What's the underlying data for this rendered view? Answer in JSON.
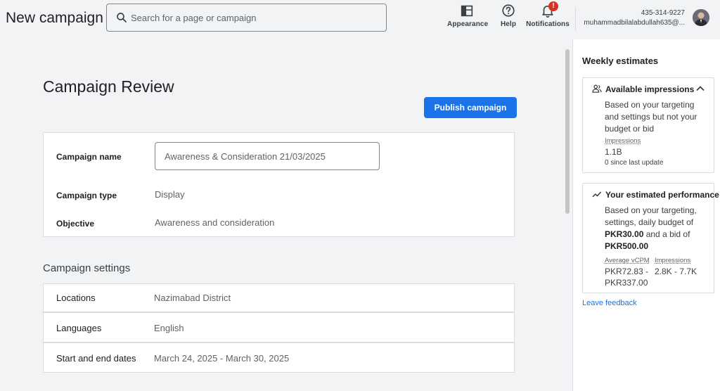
{
  "header": {
    "title": "New campaign",
    "search": {
      "placeholder": "Search for a page or campaign",
      "icon": "search-icon"
    },
    "actions": [
      {
        "label": "Appearance",
        "icon": "appearance-icon"
      },
      {
        "label": "Help",
        "icon": "help-icon"
      },
      {
        "label": "Notifications",
        "icon": "bell-icon",
        "badge": "!"
      }
    ],
    "account": {
      "phone": "435-314-9227",
      "email": "muhammadbilalabdullah635@..."
    }
  },
  "main": {
    "title": "Campaign Review",
    "publish_label": "Publish campaign",
    "details": {
      "name_label": "Campaign name",
      "name_value": "Awareness & Consideration 21/03/2025",
      "type_label": "Campaign type",
      "type_value": "Display",
      "objective_label": "Objective",
      "objective_value": "Awareness and consideration"
    },
    "settings_title": "Campaign settings",
    "settings": [
      {
        "label": "Locations",
        "value": "Nazimabad District"
      },
      {
        "label": "Languages",
        "value": "English"
      },
      {
        "label": "Start and end dates",
        "value": "March 24, 2025 - March 30, 2025"
      }
    ]
  },
  "panel": {
    "title": "Weekly estimates",
    "impressions": {
      "title": "Available impressions",
      "desc": "Based on your targeting and settings but not your budget or bid",
      "stat_label": "Impressions",
      "stat_value": "1.1B",
      "note": "0 since last update"
    },
    "performance": {
      "title": "Your estimated performance",
      "desc_pre": "Based on your targeting, settings, daily budget of ",
      "budget": "PKR30.00",
      "desc_mid": " and a bid of ",
      "bid": "PKR500.00",
      "cpm_label": "Average vCPM",
      "cpm_value_1": "PKR72.83 -",
      "cpm_value_2": "PKR337.00",
      "imp_label": "Impressions",
      "imp_value": "2.8K - 7.7K"
    },
    "feedback_label": "Leave feedback"
  },
  "colors": {
    "accent": "#1a73e8",
    "badge": "#d93025",
    "background": "#f1f3f4"
  }
}
